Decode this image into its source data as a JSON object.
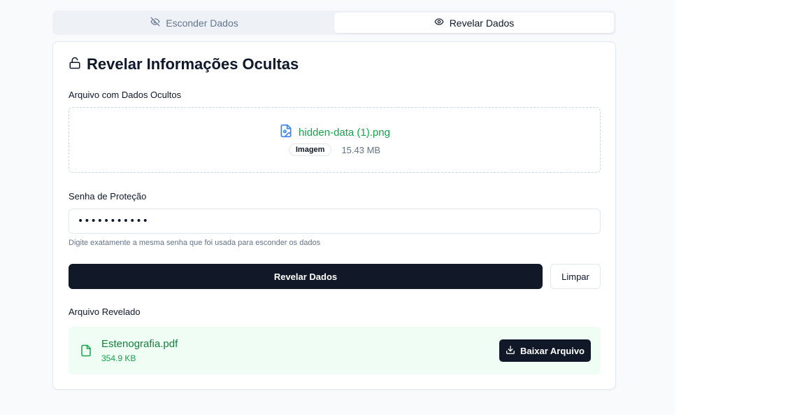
{
  "tabs": {
    "hide_label": "Esconder Dados",
    "reveal_label": "Revelar Dados",
    "active": "reveal"
  },
  "card": {
    "title": "Revelar Informações Ocultas",
    "file_section_label": "Arquivo com Dados Ocultos",
    "file": {
      "name": "hidden-data (1).png",
      "type_badge": "Imagem",
      "size": "15.43 MB"
    },
    "password_label": "Senha de Proteção",
    "password_value": "xxxxxxxxxxx",
    "password_hint": "Digite exatamente a mesma senha que foi usada para esconder os dados",
    "reveal_button": "Revelar Dados",
    "clear_button": "Limpar",
    "result_label": "Arquivo Revelado",
    "result": {
      "name": "Estenografia.pdf",
      "size": "354.9 KB",
      "download_button": "Baixar Arquivo"
    }
  },
  "colors": {
    "accent_green": "#16a34a",
    "primary_dark": "#111827",
    "result_bg": "#f0fdf4",
    "icon_blue": "#3b82f6"
  }
}
